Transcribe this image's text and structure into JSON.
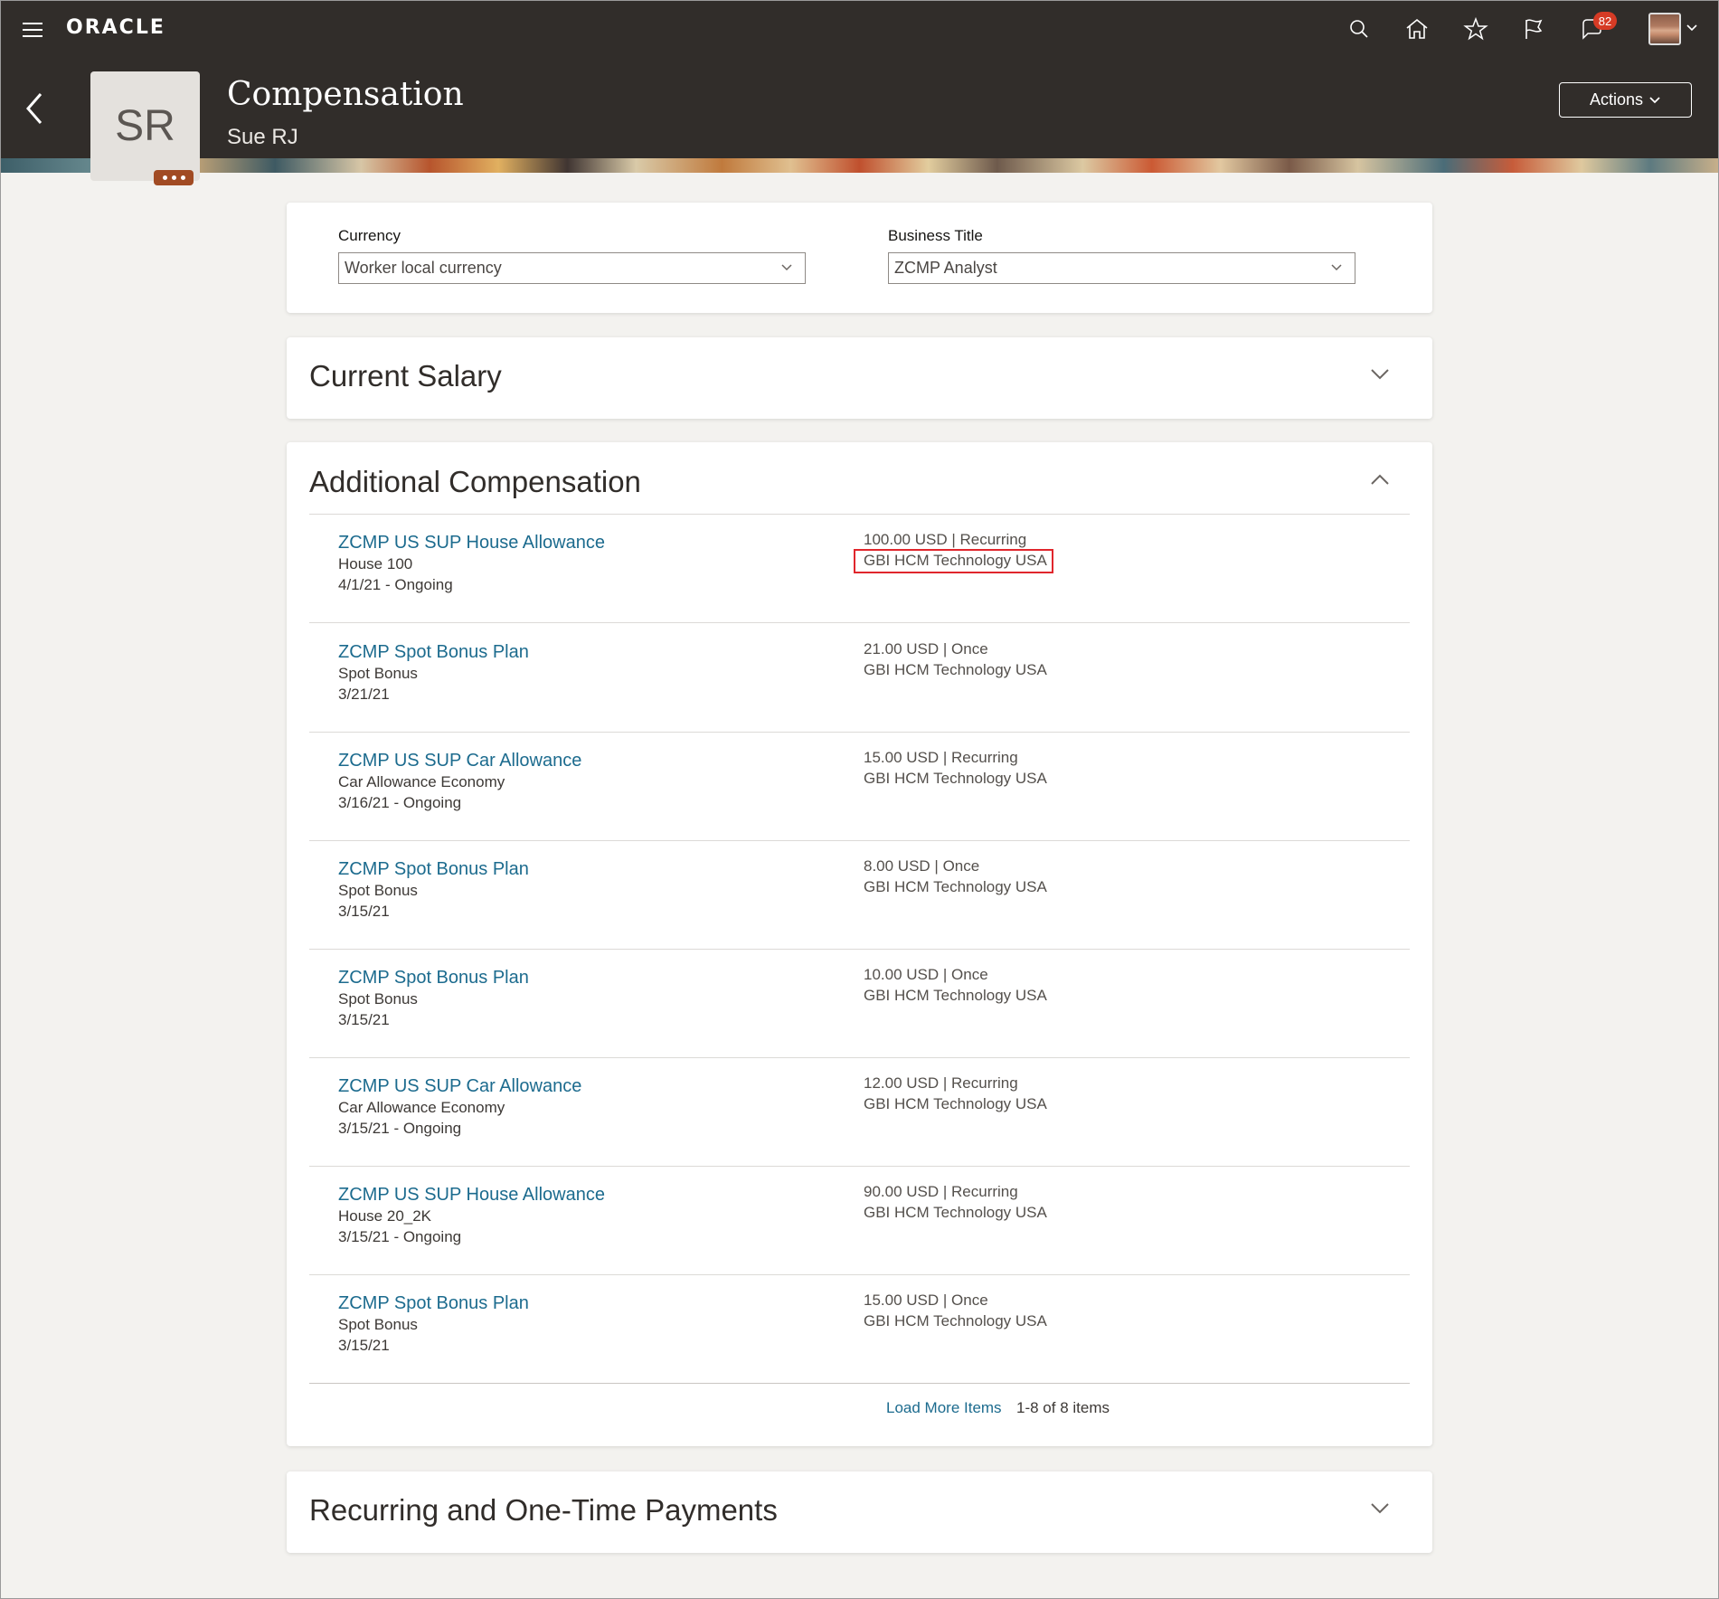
{
  "header": {
    "logo": "ORACLE",
    "notification_count": "82",
    "icons": [
      "menu-icon",
      "search-icon",
      "home-icon",
      "favorites-icon",
      "watchlist-icon",
      "notifications-icon",
      "user-avatar"
    ]
  },
  "hero": {
    "initials": "SR",
    "title": "Compensation",
    "person_name": "Sue RJ",
    "actions_label": "Actions"
  },
  "filters": {
    "currency_label": "Currency",
    "currency_value": "Worker local currency",
    "business_title_label": "Business Title",
    "business_title_value": "ZCMP Analyst"
  },
  "current_salary": {
    "title": "Current Salary"
  },
  "additional_compensation": {
    "title": "Additional Compensation",
    "items": [
      {
        "plan": "ZCMP US SUP House Allowance",
        "component": "House 100",
        "dates": "4/1/21 - Ongoing",
        "amount": "100.00 USD | Recurring",
        "legal_employer": "GBI HCM Technology USA"
      },
      {
        "plan": "ZCMP Spot Bonus Plan",
        "component": "Spot Bonus",
        "dates": "3/21/21",
        "amount": "21.00 USD | Once",
        "legal_employer": "GBI HCM Technology USA"
      },
      {
        "plan": "ZCMP US SUP Car Allowance",
        "component": "Car Allowance Economy",
        "dates": "3/16/21 - Ongoing",
        "amount": "15.00 USD | Recurring",
        "legal_employer": "GBI HCM Technology USA"
      },
      {
        "plan": "ZCMP Spot Bonus Plan",
        "component": "Spot Bonus",
        "dates": "3/15/21",
        "amount": "8.00 USD | Once",
        "legal_employer": "GBI HCM Technology USA"
      },
      {
        "plan": "ZCMP Spot Bonus Plan",
        "component": "Spot Bonus",
        "dates": "3/15/21",
        "amount": "10.00 USD | Once",
        "legal_employer": "GBI HCM Technology USA"
      },
      {
        "plan": "ZCMP US SUP Car Allowance",
        "component": "Car Allowance Economy",
        "dates": "3/15/21 - Ongoing",
        "amount": "12.00 USD | Recurring",
        "legal_employer": "GBI HCM Technology USA"
      },
      {
        "plan": "ZCMP US SUP House Allowance",
        "component": "House 20_2K",
        "dates": "3/15/21 - Ongoing",
        "amount": "90.00 USD | Recurring",
        "legal_employer": "GBI HCM Technology USA"
      },
      {
        "plan": "ZCMP Spot Bonus Plan",
        "component": "Spot Bonus",
        "dates": "3/15/21",
        "amount": "15.00 USD | Once",
        "legal_employer": "GBI HCM Technology USA"
      }
    ],
    "load_more": "Load More Items",
    "count": "1-8 of 8 items"
  },
  "recurring_payments": {
    "title": "Recurring and One-Time Payments"
  },
  "colors": {
    "header_bg": "#312d2a",
    "link": "#1c6b8e",
    "highlight_box": "#e0262c",
    "badge": "#d63b25"
  }
}
